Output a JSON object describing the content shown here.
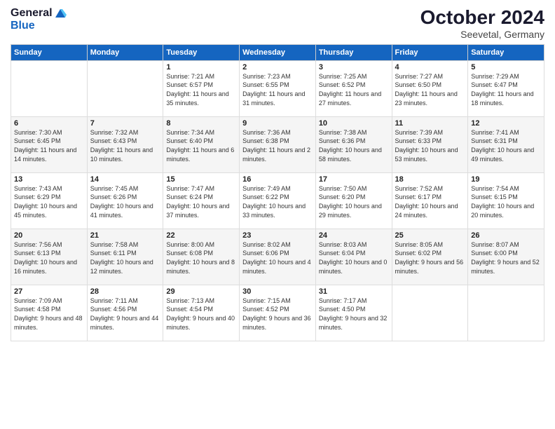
{
  "header": {
    "logo_general": "General",
    "logo_blue": "Blue",
    "month_year": "October 2024",
    "location": "Seevetal, Germany"
  },
  "days_of_week": [
    "Sunday",
    "Monday",
    "Tuesday",
    "Wednesday",
    "Thursday",
    "Friday",
    "Saturday"
  ],
  "weeks": [
    [
      {
        "day": "",
        "info": ""
      },
      {
        "day": "",
        "info": ""
      },
      {
        "day": "1",
        "info": "Sunrise: 7:21 AM\nSunset: 6:57 PM\nDaylight: 11 hours\nand 35 minutes."
      },
      {
        "day": "2",
        "info": "Sunrise: 7:23 AM\nSunset: 6:55 PM\nDaylight: 11 hours\nand 31 minutes."
      },
      {
        "day": "3",
        "info": "Sunrise: 7:25 AM\nSunset: 6:52 PM\nDaylight: 11 hours\nand 27 minutes."
      },
      {
        "day": "4",
        "info": "Sunrise: 7:27 AM\nSunset: 6:50 PM\nDaylight: 11 hours\nand 23 minutes."
      },
      {
        "day": "5",
        "info": "Sunrise: 7:29 AM\nSunset: 6:47 PM\nDaylight: 11 hours\nand 18 minutes."
      }
    ],
    [
      {
        "day": "6",
        "info": "Sunrise: 7:30 AM\nSunset: 6:45 PM\nDaylight: 11 hours\nand 14 minutes."
      },
      {
        "day": "7",
        "info": "Sunrise: 7:32 AM\nSunset: 6:43 PM\nDaylight: 11 hours\nand 10 minutes."
      },
      {
        "day": "8",
        "info": "Sunrise: 7:34 AM\nSunset: 6:40 PM\nDaylight: 11 hours\nand 6 minutes."
      },
      {
        "day": "9",
        "info": "Sunrise: 7:36 AM\nSunset: 6:38 PM\nDaylight: 11 hours\nand 2 minutes."
      },
      {
        "day": "10",
        "info": "Sunrise: 7:38 AM\nSunset: 6:36 PM\nDaylight: 10 hours\nand 58 minutes."
      },
      {
        "day": "11",
        "info": "Sunrise: 7:39 AM\nSunset: 6:33 PM\nDaylight: 10 hours\nand 53 minutes."
      },
      {
        "day": "12",
        "info": "Sunrise: 7:41 AM\nSunset: 6:31 PM\nDaylight: 10 hours\nand 49 minutes."
      }
    ],
    [
      {
        "day": "13",
        "info": "Sunrise: 7:43 AM\nSunset: 6:29 PM\nDaylight: 10 hours\nand 45 minutes."
      },
      {
        "day": "14",
        "info": "Sunrise: 7:45 AM\nSunset: 6:26 PM\nDaylight: 10 hours\nand 41 minutes."
      },
      {
        "day": "15",
        "info": "Sunrise: 7:47 AM\nSunset: 6:24 PM\nDaylight: 10 hours\nand 37 minutes."
      },
      {
        "day": "16",
        "info": "Sunrise: 7:49 AM\nSunset: 6:22 PM\nDaylight: 10 hours\nand 33 minutes."
      },
      {
        "day": "17",
        "info": "Sunrise: 7:50 AM\nSunset: 6:20 PM\nDaylight: 10 hours\nand 29 minutes."
      },
      {
        "day": "18",
        "info": "Sunrise: 7:52 AM\nSunset: 6:17 PM\nDaylight: 10 hours\nand 24 minutes."
      },
      {
        "day": "19",
        "info": "Sunrise: 7:54 AM\nSunset: 6:15 PM\nDaylight: 10 hours\nand 20 minutes."
      }
    ],
    [
      {
        "day": "20",
        "info": "Sunrise: 7:56 AM\nSunset: 6:13 PM\nDaylight: 10 hours\nand 16 minutes."
      },
      {
        "day": "21",
        "info": "Sunrise: 7:58 AM\nSunset: 6:11 PM\nDaylight: 10 hours\nand 12 minutes."
      },
      {
        "day": "22",
        "info": "Sunrise: 8:00 AM\nSunset: 6:08 PM\nDaylight: 10 hours\nand 8 minutes."
      },
      {
        "day": "23",
        "info": "Sunrise: 8:02 AM\nSunset: 6:06 PM\nDaylight: 10 hours\nand 4 minutes."
      },
      {
        "day": "24",
        "info": "Sunrise: 8:03 AM\nSunset: 6:04 PM\nDaylight: 10 hours\nand 0 minutes."
      },
      {
        "day": "25",
        "info": "Sunrise: 8:05 AM\nSunset: 6:02 PM\nDaylight: 9 hours\nand 56 minutes."
      },
      {
        "day": "26",
        "info": "Sunrise: 8:07 AM\nSunset: 6:00 PM\nDaylight: 9 hours\nand 52 minutes."
      }
    ],
    [
      {
        "day": "27",
        "info": "Sunrise: 7:09 AM\nSunset: 4:58 PM\nDaylight: 9 hours\nand 48 minutes."
      },
      {
        "day": "28",
        "info": "Sunrise: 7:11 AM\nSunset: 4:56 PM\nDaylight: 9 hours\nand 44 minutes."
      },
      {
        "day": "29",
        "info": "Sunrise: 7:13 AM\nSunset: 4:54 PM\nDaylight: 9 hours\nand 40 minutes."
      },
      {
        "day": "30",
        "info": "Sunrise: 7:15 AM\nSunset: 4:52 PM\nDaylight: 9 hours\nand 36 minutes."
      },
      {
        "day": "31",
        "info": "Sunrise: 7:17 AM\nSunset: 4:50 PM\nDaylight: 9 hours\nand 32 minutes."
      },
      {
        "day": "",
        "info": ""
      },
      {
        "day": "",
        "info": ""
      }
    ]
  ]
}
